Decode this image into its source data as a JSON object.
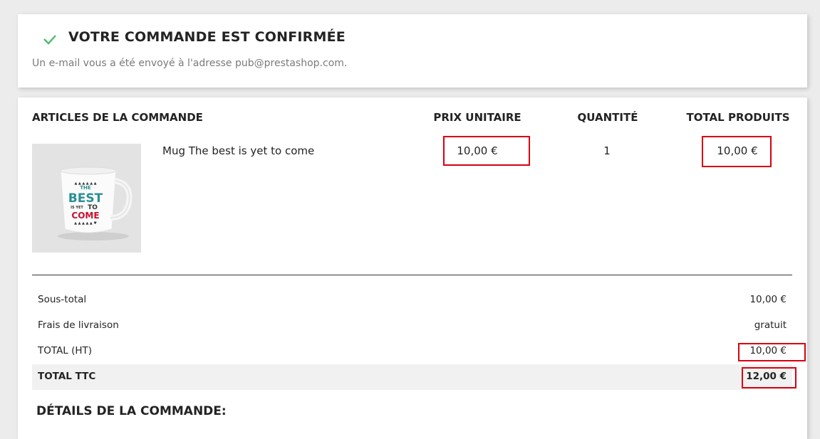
{
  "confirmation": {
    "title": "VOTRE COMMANDE EST CONFIRMÉE",
    "email_message": "Un e-mail vous a été envoyé à l'adresse pub@prestashop.com.",
    "check_color": "#4cbb6c"
  },
  "order": {
    "headers": {
      "articles": "ARTICLES DE LA COMMANDE",
      "unit_price": "PRIX UNITAIRE",
      "quantity": "QUANTITÉ",
      "total": "TOTAL PRODUITS"
    },
    "items": [
      {
        "name": "Mug The best is yet to come",
        "unit_price": "10,00 €",
        "quantity": "1",
        "total": "10,00 €",
        "image_text": [
          "THE",
          "BEST",
          "IS YET",
          "TO",
          "COME"
        ]
      }
    ],
    "summary": {
      "subtotal_label": "Sous-total",
      "subtotal_value": "10,00 €",
      "shipping_label": "Frais de livraison",
      "shipping_value": "gratuit",
      "total_ht_label": "TOTAL (HT)",
      "total_ht_value": "10,00 €",
      "total_ttc_label": "TOTAL TTC",
      "total_ttc_value": "12,00 €"
    },
    "details_title": "DÉTAILS DE LA COMMANDE:"
  },
  "colors": {
    "highlight": "#d9000f",
    "mug_teal": "#2b8f94",
    "mug_red": "#c8102e"
  }
}
